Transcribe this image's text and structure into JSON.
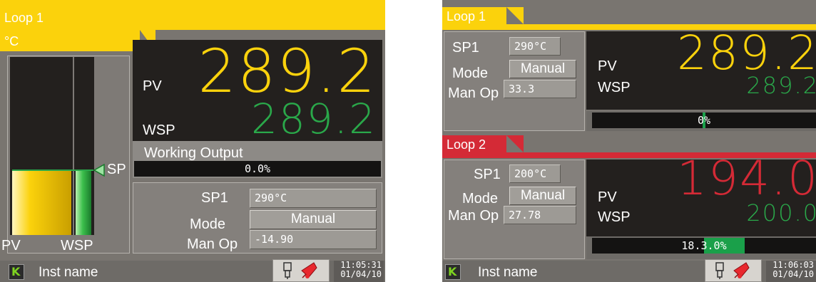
{
  "left": {
    "title": "Loop 1",
    "units": "°C",
    "pv_label": "PV",
    "pv_value": "289.2",
    "wsp_label": "WSP",
    "wsp_value": "289.2",
    "sp_marker": "SP",
    "working_output_label": "Working Output",
    "working_output_value": "0.0%",
    "bar_pv_label": "PV",
    "bar_wsp_label": "WSP",
    "sp1_label": "SP1",
    "sp1_value": "290°C",
    "mode_label": "Mode",
    "mode_value": "Manual",
    "manop_label": "Man Op",
    "manop_value": "-14.90",
    "instrument_name": "Inst name",
    "time": "11:05:31",
    "date": "01/04/10"
  },
  "right": {
    "loop1": {
      "title": "Loop 1",
      "sp1_label": "SP1",
      "sp1_value": "290°C",
      "mode_label": "Mode",
      "mode_value": "Manual",
      "manop_label": "Man Op",
      "manop_value": "33.3",
      "pv_label": "PV",
      "pv_value": "289.2",
      "wsp_label": "WSP",
      "wsp_value": "289.2",
      "output_value": "0%"
    },
    "loop2": {
      "title": "Loop 2",
      "sp1_label": "SP1",
      "sp1_value": "200°C",
      "mode_label": "Mode",
      "mode_value": "Manual",
      "manop_label": "Man Op",
      "manop_value": "27.78",
      "pv_label": "PV",
      "pv_value": "194.0",
      "wsp_label": "WSP",
      "wsp_value": "200.0",
      "output_value": "18.3.0%"
    },
    "instrument_name": "Inst name",
    "time": "11:06:03",
    "date": "01/04/10"
  },
  "colors": {
    "loop1_tab": "#fbd20c",
    "loop2_tab": "#d42a36",
    "pv_yellow": "#fbd20c",
    "pv_red": "#d42a36",
    "wsp_green": "#2aa84a"
  },
  "icons": [
    "usb-icon",
    "alarm-bell-icon",
    "k-logo-icon"
  ],
  "levels": {
    "left_pv_bar_fraction": 0.36,
    "left_wsp_bar_fraction": 0.36,
    "left_sp_marker_fraction": 0.37,
    "right_loop1_output_fraction": 0.0,
    "right_loop2_output_fraction": 0.183
  }
}
